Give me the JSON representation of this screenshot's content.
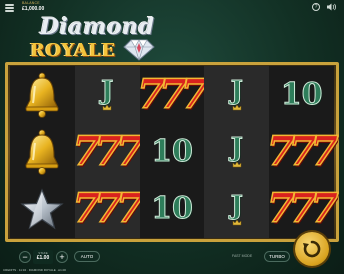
{
  "top": {
    "menu_icon": "hamburger-menu-icon",
    "balance_label": "BALANCE",
    "balance_value": "£1,000.00",
    "help_icon_glyph": "?",
    "sound_icon": "speaker-icon"
  },
  "logo": {
    "title": "Diamond",
    "subtitle": "ROYALE"
  },
  "reels": {
    "columns": 5,
    "rows": 3,
    "grid": [
      [
        "bell",
        "J",
        "777",
        "J",
        "10"
      ],
      [
        "bell",
        "777",
        "10",
        "J",
        "777"
      ],
      [
        "star",
        "777",
        "10",
        "J",
        "777"
      ]
    ],
    "text": {
      "seven": "777",
      "ten": "10",
      "jack": "J"
    }
  },
  "controls": {
    "minus": "−",
    "plus": "+",
    "stake_label": "STAKE",
    "stake_value": "£1.00",
    "auto_label": "AUTO",
    "fast_mode_label": "FAST MODE",
    "turbo_label": "TURBO",
    "spin_icon": "spin-arrows-icon"
  },
  "footer": {
    "text": "CREDITS  ·  11:32  ·  DIAMOND ROYALE  ·  £1.00"
  },
  "colors": {
    "background": "#123024",
    "frame_gold": "#c9a23c",
    "seven_red": "#d9221e",
    "royal_green": "#2e7d5a",
    "spin_gold": "#d9a21e"
  }
}
